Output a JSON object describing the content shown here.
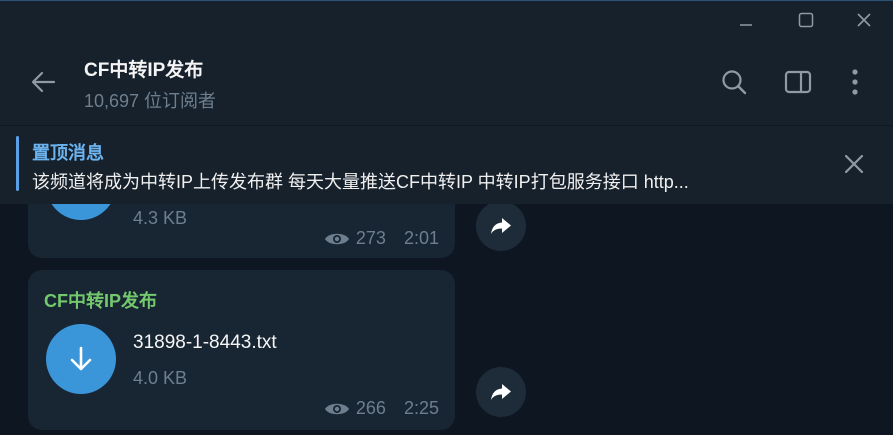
{
  "channel": {
    "title": "CF中转IP发布",
    "subscribers": "10,697 位订阅者"
  },
  "pinned": {
    "title": "置顶消息",
    "text": "该频道将成为中转IP上传发布群 每天大量推送CF中转IP 中转IP打包服务接口 http..."
  },
  "messages": [
    {
      "file_size": "4.3 KB",
      "views": "273",
      "time": "2:01"
    },
    {
      "sender": "CF中转IP发布",
      "file_name": "31898-1-8443.txt",
      "file_size": "4.0 KB",
      "views": "266",
      "time": "2:25"
    }
  ],
  "icons": {
    "back": "arrow-left-icon",
    "search": "search-icon",
    "sidebar": "sidebar-toggle-icon",
    "more": "more-vertical-icon",
    "download": "download-icon",
    "forward": "forward-icon",
    "views": "eye-icon"
  },
  "colors": {
    "accent": "#3a95d9",
    "sender": "#73c96c",
    "pinned_title": "#6cb4f0",
    "background": "#0e1621",
    "panel": "#17212b",
    "bubble": "#182533"
  }
}
